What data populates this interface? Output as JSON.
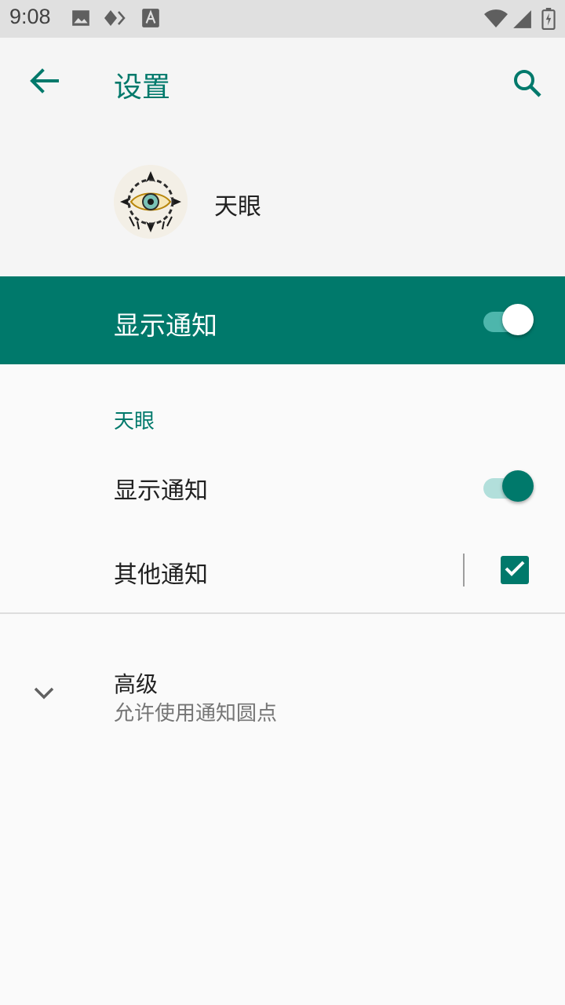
{
  "status_bar": {
    "time": "9:08",
    "icons": [
      "image-icon",
      "diamond-icon",
      "font-a-icon",
      "wifi-icon",
      "signal-icon",
      "battery-charging-icon"
    ]
  },
  "app_bar": {
    "title": "设置",
    "back_icon": "arrow-back-icon",
    "search_icon": "search-icon"
  },
  "app_header": {
    "app_name": "天眼"
  },
  "master_toggle": {
    "label": "显示通知",
    "checked": true
  },
  "category": {
    "header": "天眼",
    "items": [
      {
        "label": "显示通知",
        "control": "switch",
        "checked": true
      },
      {
        "label": "其他通知",
        "control": "checkbox",
        "checked": true
      }
    ]
  },
  "advanced": {
    "title": "高级",
    "summary": "允许使用通知圆点",
    "icon": "chevron-down-icon"
  },
  "colors": {
    "accent": "#00796b",
    "status_bar": "#e0e0e0",
    "app_bar": "#f5f5f5",
    "background": "#fafafa"
  }
}
